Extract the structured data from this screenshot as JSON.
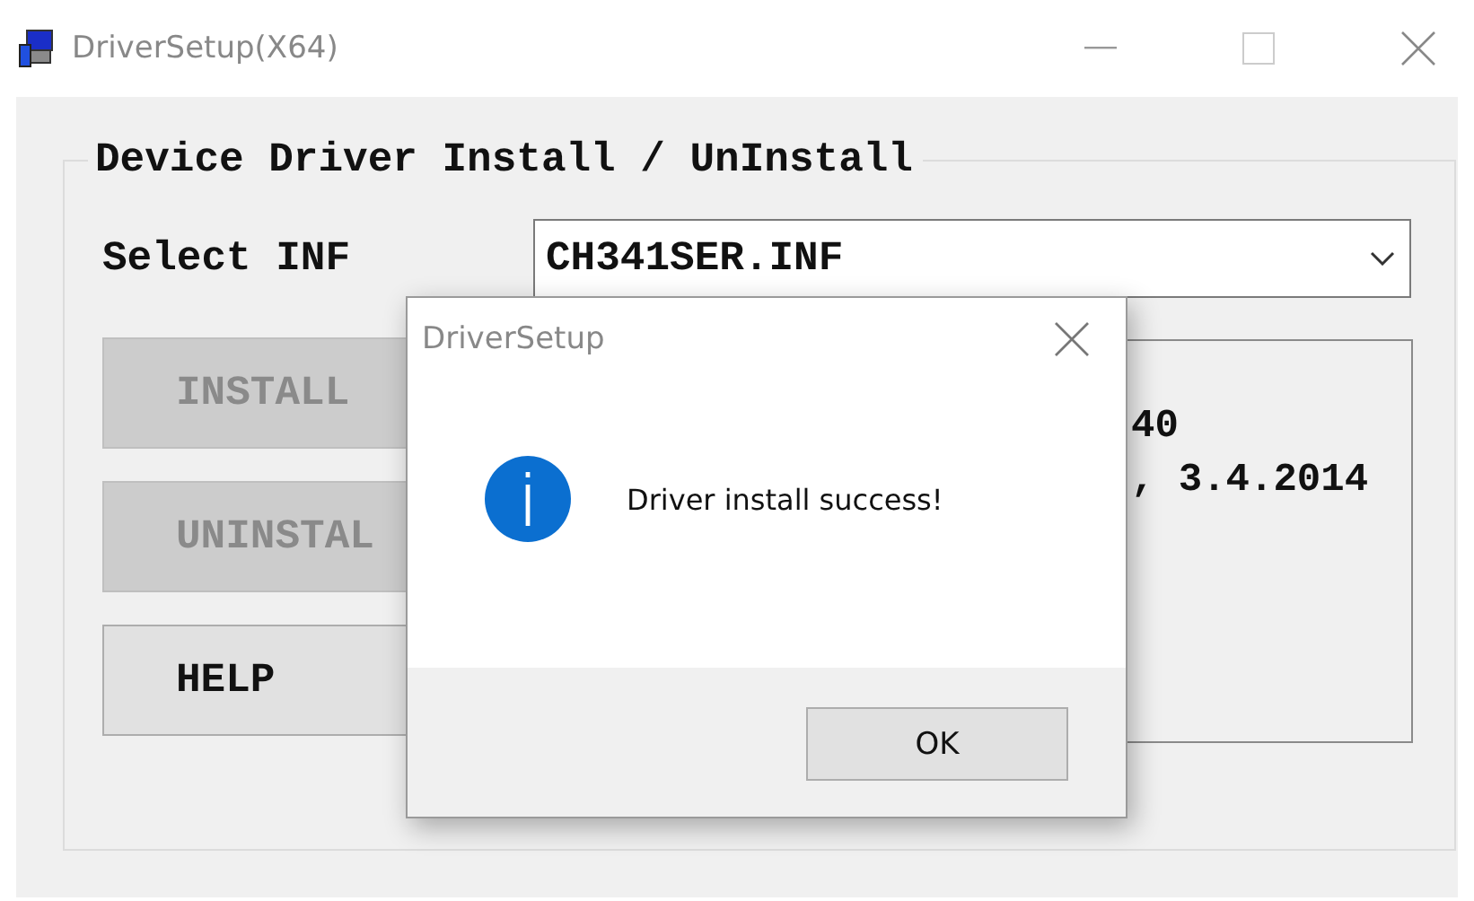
{
  "window": {
    "title": "DriverSetup(X64)"
  },
  "group": {
    "title": "Device Driver Install / UnInstall"
  },
  "select_inf": {
    "label": "Select INF",
    "value": "CH341SER.INF"
  },
  "buttons": [
    {
      "label": "INSTALL",
      "disabled": true
    },
    {
      "label": "UNINSTAL",
      "disabled": true
    },
    {
      "label": "HELP",
      "disabled": false
    }
  ],
  "info_lines": [
    "40",
    ", 3.4.2014"
  ],
  "dialog": {
    "title": "DriverSetup",
    "message": "Driver install success!",
    "button": "OK"
  }
}
